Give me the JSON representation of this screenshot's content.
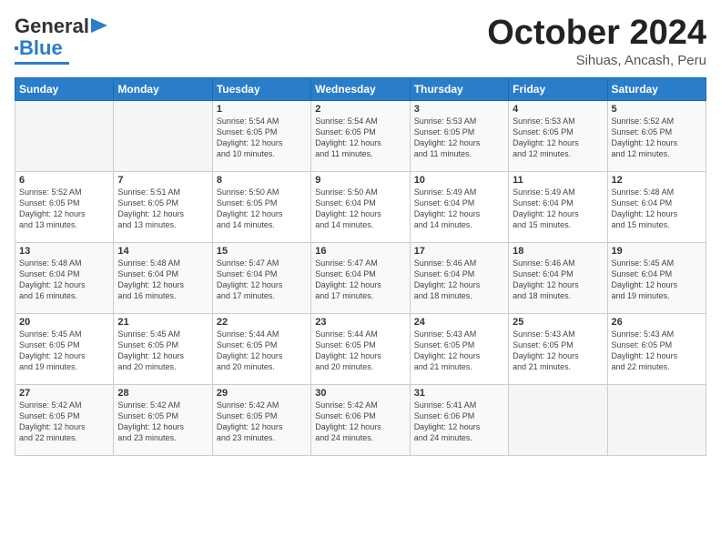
{
  "logo": {
    "line1": "General",
    "line2": "Blue"
  },
  "header": {
    "month": "October 2024",
    "location": "Sihuas, Ancash, Peru"
  },
  "weekdays": [
    "Sunday",
    "Monday",
    "Tuesday",
    "Wednesday",
    "Thursday",
    "Friday",
    "Saturday"
  ],
  "weeks": [
    [
      {
        "day": "",
        "info": ""
      },
      {
        "day": "",
        "info": ""
      },
      {
        "day": "1",
        "info": "Sunrise: 5:54 AM\nSunset: 6:05 PM\nDaylight: 12 hours\nand 10 minutes."
      },
      {
        "day": "2",
        "info": "Sunrise: 5:54 AM\nSunset: 6:05 PM\nDaylight: 12 hours\nand 11 minutes."
      },
      {
        "day": "3",
        "info": "Sunrise: 5:53 AM\nSunset: 6:05 PM\nDaylight: 12 hours\nand 11 minutes."
      },
      {
        "day": "4",
        "info": "Sunrise: 5:53 AM\nSunset: 6:05 PM\nDaylight: 12 hours\nand 12 minutes."
      },
      {
        "day": "5",
        "info": "Sunrise: 5:52 AM\nSunset: 6:05 PM\nDaylight: 12 hours\nand 12 minutes."
      }
    ],
    [
      {
        "day": "6",
        "info": "Sunrise: 5:52 AM\nSunset: 6:05 PM\nDaylight: 12 hours\nand 13 minutes."
      },
      {
        "day": "7",
        "info": "Sunrise: 5:51 AM\nSunset: 6:05 PM\nDaylight: 12 hours\nand 13 minutes."
      },
      {
        "day": "8",
        "info": "Sunrise: 5:50 AM\nSunset: 6:05 PM\nDaylight: 12 hours\nand 14 minutes."
      },
      {
        "day": "9",
        "info": "Sunrise: 5:50 AM\nSunset: 6:04 PM\nDaylight: 12 hours\nand 14 minutes."
      },
      {
        "day": "10",
        "info": "Sunrise: 5:49 AM\nSunset: 6:04 PM\nDaylight: 12 hours\nand 14 minutes."
      },
      {
        "day": "11",
        "info": "Sunrise: 5:49 AM\nSunset: 6:04 PM\nDaylight: 12 hours\nand 15 minutes."
      },
      {
        "day": "12",
        "info": "Sunrise: 5:48 AM\nSunset: 6:04 PM\nDaylight: 12 hours\nand 15 minutes."
      }
    ],
    [
      {
        "day": "13",
        "info": "Sunrise: 5:48 AM\nSunset: 6:04 PM\nDaylight: 12 hours\nand 16 minutes."
      },
      {
        "day": "14",
        "info": "Sunrise: 5:48 AM\nSunset: 6:04 PM\nDaylight: 12 hours\nand 16 minutes."
      },
      {
        "day": "15",
        "info": "Sunrise: 5:47 AM\nSunset: 6:04 PM\nDaylight: 12 hours\nand 17 minutes."
      },
      {
        "day": "16",
        "info": "Sunrise: 5:47 AM\nSunset: 6:04 PM\nDaylight: 12 hours\nand 17 minutes."
      },
      {
        "day": "17",
        "info": "Sunrise: 5:46 AM\nSunset: 6:04 PM\nDaylight: 12 hours\nand 18 minutes."
      },
      {
        "day": "18",
        "info": "Sunrise: 5:46 AM\nSunset: 6:04 PM\nDaylight: 12 hours\nand 18 minutes."
      },
      {
        "day": "19",
        "info": "Sunrise: 5:45 AM\nSunset: 6:04 PM\nDaylight: 12 hours\nand 19 minutes."
      }
    ],
    [
      {
        "day": "20",
        "info": "Sunrise: 5:45 AM\nSunset: 6:05 PM\nDaylight: 12 hours\nand 19 minutes."
      },
      {
        "day": "21",
        "info": "Sunrise: 5:45 AM\nSunset: 6:05 PM\nDaylight: 12 hours\nand 20 minutes."
      },
      {
        "day": "22",
        "info": "Sunrise: 5:44 AM\nSunset: 6:05 PM\nDaylight: 12 hours\nand 20 minutes."
      },
      {
        "day": "23",
        "info": "Sunrise: 5:44 AM\nSunset: 6:05 PM\nDaylight: 12 hours\nand 20 minutes."
      },
      {
        "day": "24",
        "info": "Sunrise: 5:43 AM\nSunset: 6:05 PM\nDaylight: 12 hours\nand 21 minutes."
      },
      {
        "day": "25",
        "info": "Sunrise: 5:43 AM\nSunset: 6:05 PM\nDaylight: 12 hours\nand 21 minutes."
      },
      {
        "day": "26",
        "info": "Sunrise: 5:43 AM\nSunset: 6:05 PM\nDaylight: 12 hours\nand 22 minutes."
      }
    ],
    [
      {
        "day": "27",
        "info": "Sunrise: 5:42 AM\nSunset: 6:05 PM\nDaylight: 12 hours\nand 22 minutes."
      },
      {
        "day": "28",
        "info": "Sunrise: 5:42 AM\nSunset: 6:05 PM\nDaylight: 12 hours\nand 23 minutes."
      },
      {
        "day": "29",
        "info": "Sunrise: 5:42 AM\nSunset: 6:05 PM\nDaylight: 12 hours\nand 23 minutes."
      },
      {
        "day": "30",
        "info": "Sunrise: 5:42 AM\nSunset: 6:06 PM\nDaylight: 12 hours\nand 24 minutes."
      },
      {
        "day": "31",
        "info": "Sunrise: 5:41 AM\nSunset: 6:06 PM\nDaylight: 12 hours\nand 24 minutes."
      },
      {
        "day": "",
        "info": ""
      },
      {
        "day": "",
        "info": ""
      }
    ]
  ]
}
